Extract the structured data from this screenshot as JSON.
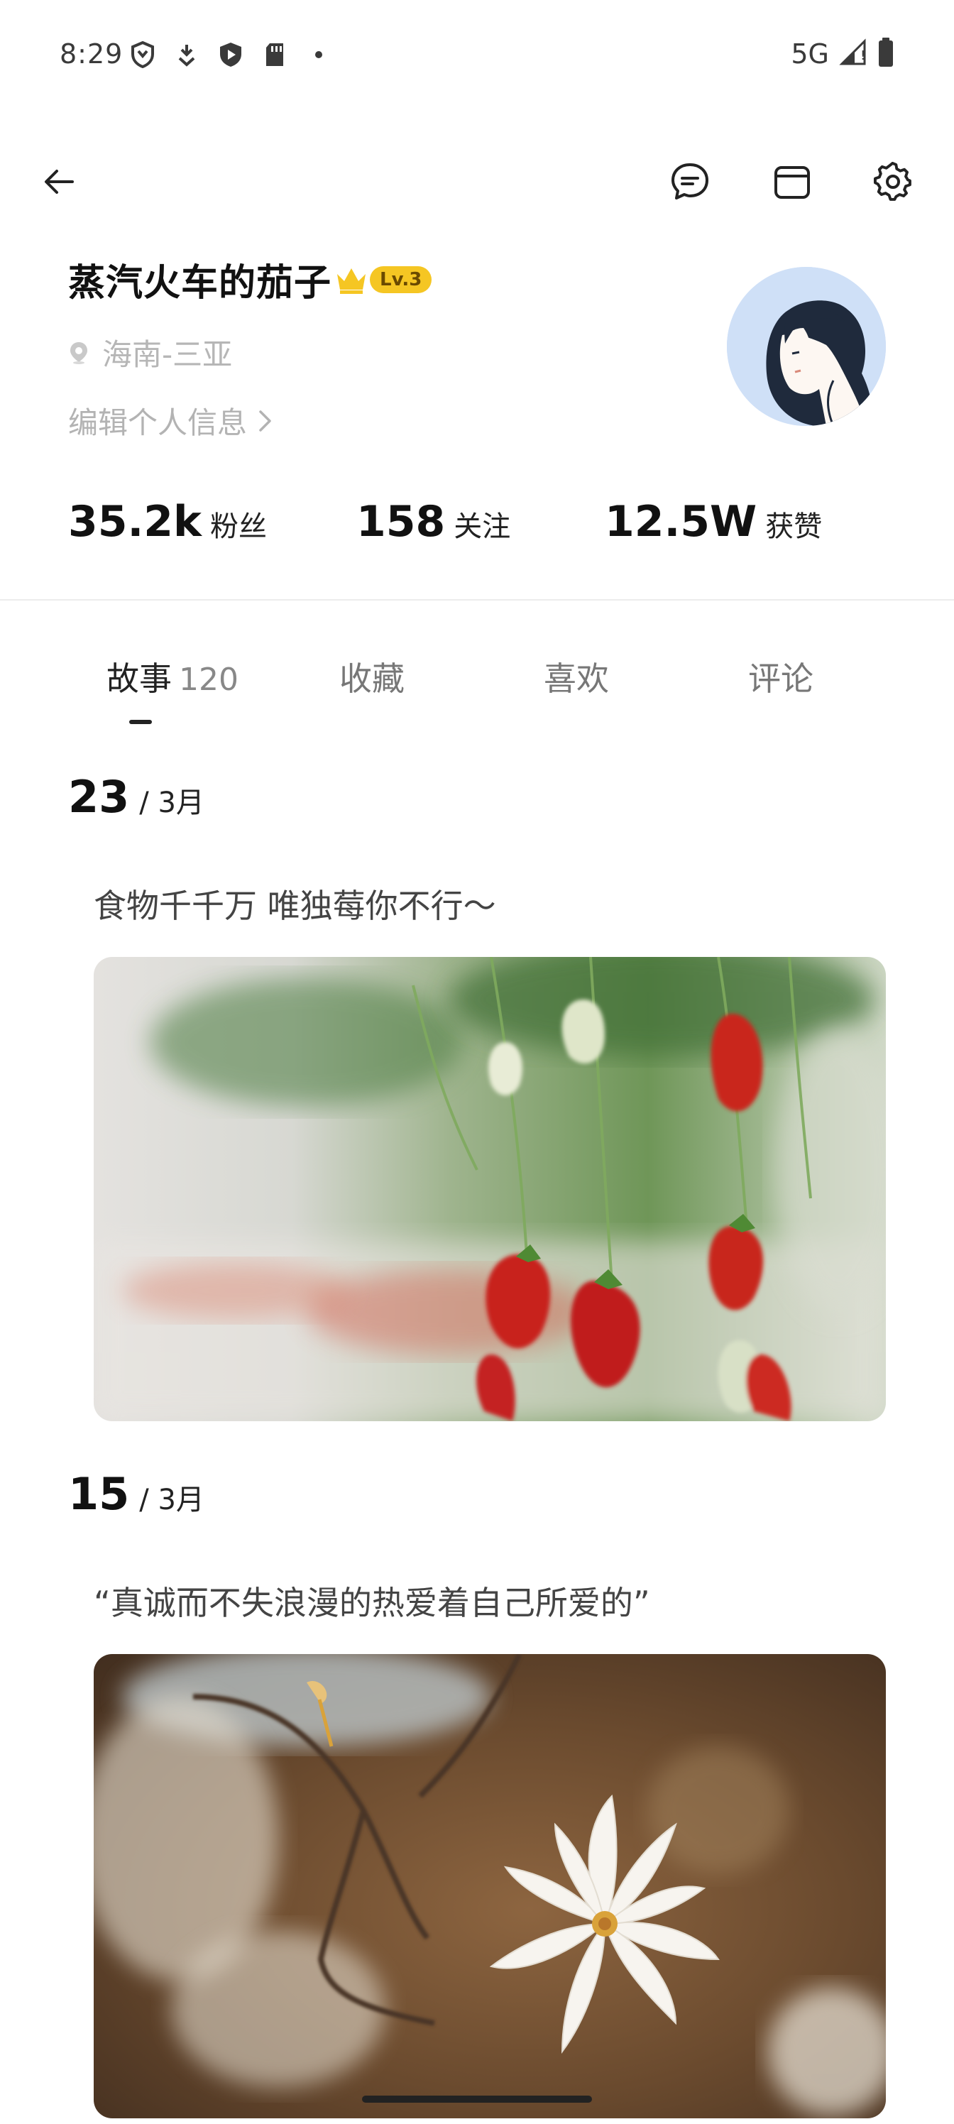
{
  "status_bar": {
    "time": "8:29",
    "network": "5G",
    "icons": [
      "shield-outline-icon",
      "download-arrow-icon",
      "play-shield-icon",
      "sd-card-icon",
      "dot-icon",
      "signal-icon",
      "battery-icon"
    ]
  },
  "toolbar": {
    "back_icon": "arrow-left-icon",
    "message_icon": "chat-bubble-icon",
    "calendar_icon": "calendar-icon",
    "settings_icon": "gear-icon"
  },
  "profile": {
    "name": "蒸汽火车的茄子",
    "level": "Lv.3",
    "location": "海南-三亚",
    "edit_info_label": "编辑个人信息",
    "accent_color": "#f5c623"
  },
  "stats": {
    "fans_value": "35.2k",
    "fans_label": "粉丝",
    "following_value": "158",
    "following_label": "关注",
    "likes_value": "12.5W",
    "likes_label": "获赞"
  },
  "tabs": [
    {
      "label": "故事",
      "count": "120",
      "active": true
    },
    {
      "label": "收藏",
      "active": false
    },
    {
      "label": "喜欢",
      "active": false
    },
    {
      "label": "评论",
      "active": false
    }
  ],
  "posts": [
    {
      "day": "23",
      "month": "/ 3月",
      "text": "食物千千万 唯独莓你不行～",
      "image": "strawberry-photo"
    },
    {
      "day": "15",
      "month": "/ 3月",
      "text": "“真诚而不失浪漫的热爱着自己所爱的”",
      "image": "white-flower-photo"
    }
  ]
}
